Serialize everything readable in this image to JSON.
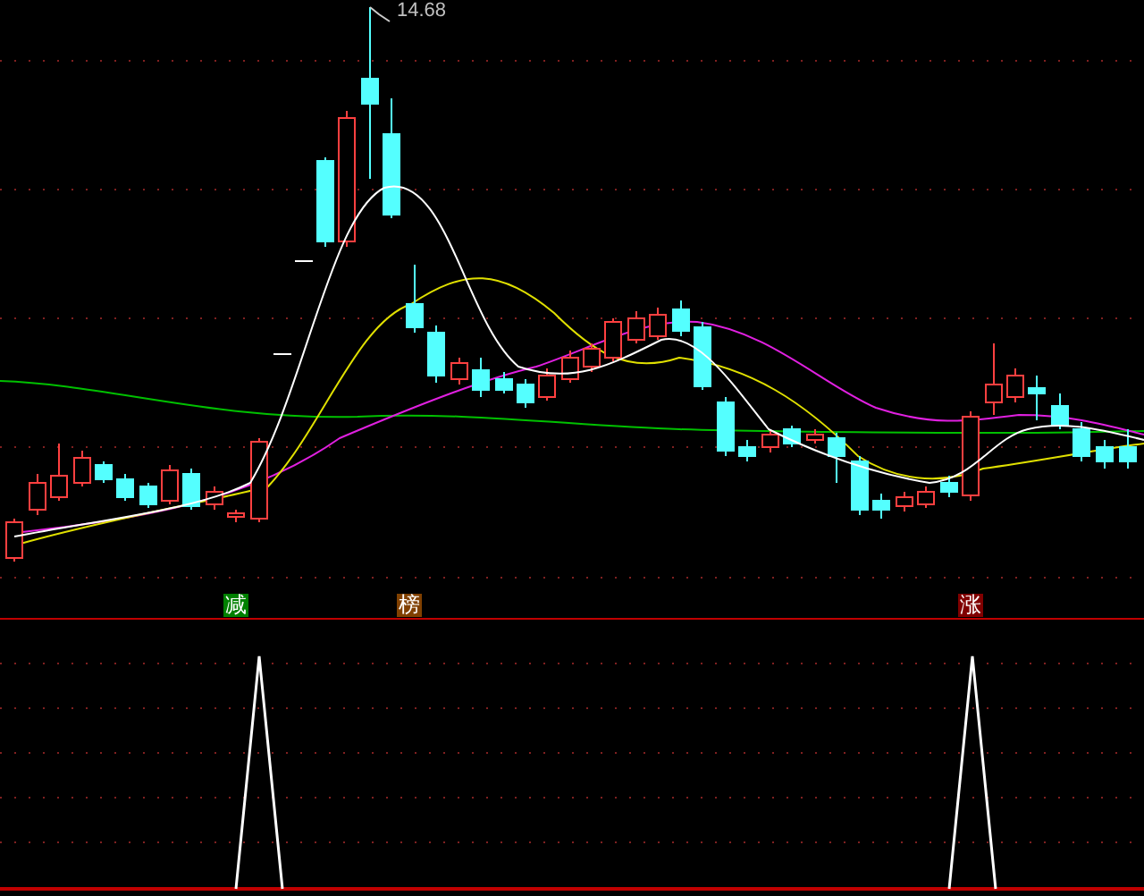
{
  "price_chart": {
    "high_label": "14.68"
  },
  "signals": [
    {
      "text": "减",
      "color": "#008000"
    },
    {
      "text": "榜",
      "color": "#804000"
    },
    {
      "text": "涨",
      "color": "#800000"
    }
  ]
}
